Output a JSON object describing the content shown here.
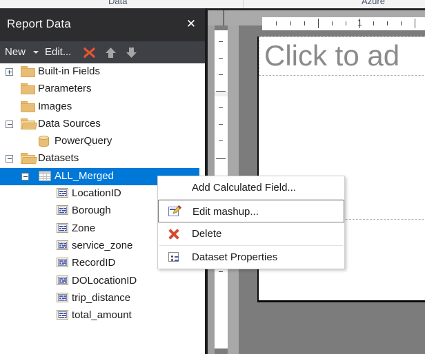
{
  "ribbon": {
    "tabs": [
      {
        "label": "Data"
      },
      {
        "label": "Azure"
      }
    ]
  },
  "panel": {
    "title": "Report Data",
    "close_label": "✕",
    "toolbar": {
      "new_label": "New",
      "edit_label": "Edit...",
      "delete_icon": "delete-x-icon",
      "move_up_icon": "arrow-up-icon",
      "move_down_icon": "arrow-down-icon",
      "accent_color": "#e8542f"
    }
  },
  "tree": {
    "items": [
      {
        "label": "Built-in Fields",
        "icon": "folder-icon",
        "indent": 0,
        "expander": "plus",
        "selected": false
      },
      {
        "label": "Parameters",
        "icon": "folder-icon",
        "indent": 0,
        "expander": "none",
        "selected": false
      },
      {
        "label": "Images",
        "icon": "folder-icon",
        "indent": 0,
        "expander": "none",
        "selected": false
      },
      {
        "label": "Data Sources",
        "icon": "folder-open-icon",
        "indent": 0,
        "expander": "minus",
        "selected": false
      },
      {
        "label": "PowerQuery",
        "icon": "database-icon",
        "indent": 1,
        "expander": "none",
        "selected": false
      },
      {
        "label": "Datasets",
        "icon": "folder-open-icon",
        "indent": 0,
        "expander": "minus",
        "selected": false
      },
      {
        "label": "ALL_Merged",
        "icon": "dataset-grid-icon",
        "indent": 1,
        "expander": "minus",
        "selected": true
      },
      {
        "label": "LocationID",
        "icon": "field-icon",
        "indent": 2,
        "expander": "none",
        "selected": false
      },
      {
        "label": "Borough",
        "icon": "field-icon",
        "indent": 2,
        "expander": "none",
        "selected": false
      },
      {
        "label": "Zone",
        "icon": "field-icon",
        "indent": 2,
        "expander": "none",
        "selected": false
      },
      {
        "label": "service_zone",
        "icon": "field-icon",
        "indent": 2,
        "expander": "none",
        "selected": false
      },
      {
        "label": "RecordID",
        "icon": "field-icon",
        "indent": 2,
        "expander": "none",
        "selected": false
      },
      {
        "label": "DOLocationID",
        "icon": "field-icon",
        "indent": 2,
        "expander": "none",
        "selected": false
      },
      {
        "label": "trip_distance",
        "icon": "field-icon",
        "indent": 2,
        "expander": "none",
        "selected": false
      },
      {
        "label": "total_amount",
        "icon": "field-icon",
        "indent": 2,
        "expander": "none",
        "selected": false
      }
    ],
    "selection_color": "#0078d7"
  },
  "context_menu": {
    "items": [
      {
        "label": "Add Calculated Field...",
        "icon": "none",
        "separator_after": true,
        "highlighted": false
      },
      {
        "label": "Edit mashup...",
        "icon": "mashup-icon",
        "separator_after": false,
        "highlighted": true
      },
      {
        "label": "Delete",
        "icon": "delete-x-icon",
        "separator_after": true,
        "highlighted": false
      },
      {
        "label": "Dataset Properties",
        "icon": "properties-icon",
        "separator_after": false,
        "highlighted": false
      }
    ]
  },
  "designer": {
    "title_placeholder": "Click to ad",
    "hruler": {
      "labels": [
        {
          "text": "1",
          "pos": 141
        }
      ],
      "minor_ticks": [
        20,
        41,
        61,
        101,
        121,
        161,
        181,
        201,
        221,
        241,
        261
      ],
      "major_ticks": [
        81,
        141,
        221
      ]
    },
    "vruler": {
      "minor_ticks": [
        16,
        40,
        64,
        112,
        136,
        160,
        290,
        320,
        350
      ],
      "major_ticks": [
        88,
        186
      ]
    }
  }
}
